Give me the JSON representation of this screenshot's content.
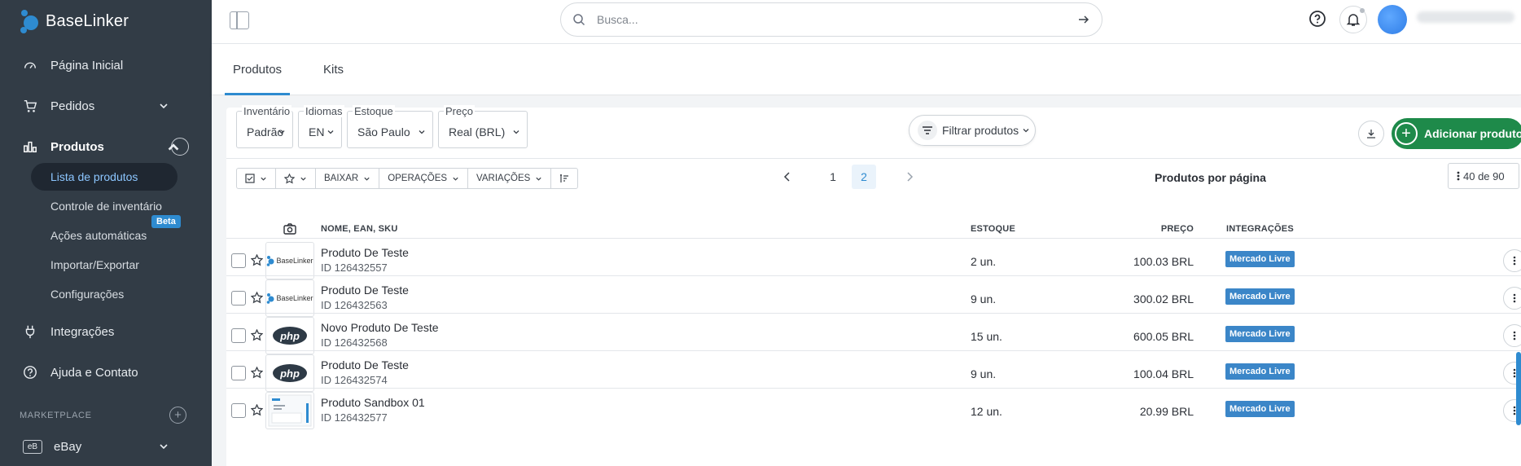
{
  "app": {
    "brand": "BaseLinker"
  },
  "sidebar": {
    "items": [
      {
        "label": "Página Inicial",
        "icon": "gauge-icon"
      },
      {
        "label": "Pedidos",
        "icon": "cart-icon"
      },
      {
        "label": "Produtos",
        "icon": "products-icon"
      },
      {
        "label": "Integrações",
        "icon": "plug-icon"
      },
      {
        "label": "Ajuda e Contato",
        "icon": "help-icon"
      }
    ],
    "products_sub": [
      {
        "label": "Lista de produtos"
      },
      {
        "label": "Controle de inventário"
      },
      {
        "label": "Ações automáticas",
        "badge": "Beta"
      },
      {
        "label": "Importar/Exportar"
      },
      {
        "label": "Configurações"
      }
    ],
    "marketplace_label": "MARKETPLACE",
    "marketplace": [
      {
        "badge": "eB",
        "label": "eBay"
      }
    ]
  },
  "topbar": {
    "search_placeholder": "Busca..."
  },
  "tabs": [
    {
      "label": "Produtos",
      "active": true
    },
    {
      "label": "Kits",
      "active": false
    }
  ],
  "filters": [
    {
      "label": "Inventário",
      "value": "Padrão"
    },
    {
      "label": "Idiomas",
      "value": "EN"
    },
    {
      "label": "Estoque",
      "value": "São Paulo"
    },
    {
      "label": "Preço",
      "value": "Real (BRL)"
    }
  ],
  "filter_button": "Filtrar produtos",
  "add_button": "Adicionar produto",
  "toolbar": {
    "baixar": "BAIXAR",
    "operacoes": "OPERAÇÕES",
    "variacoes": "VARIAÇÕES"
  },
  "pagination": {
    "pages": [
      "1",
      "2"
    ],
    "current": "2"
  },
  "per_page": {
    "label": "Produtos por página",
    "value": "40 de 90"
  },
  "table": {
    "headers": {
      "name": "NOME, EAN, SKU",
      "stock": "ESTOQUE",
      "price": "PREÇO",
      "integrations": "INTEGRAÇÕES"
    },
    "rows": [
      {
        "name": "Produto De Teste",
        "id": "ID 126432557",
        "stock": "2 un.",
        "price": "100.03 BRL",
        "integration": "Mercado Livre",
        "thumb": "baselinker"
      },
      {
        "name": "Produto De Teste",
        "id": "ID 126432563",
        "stock": "9 un.",
        "price": "300.02 BRL",
        "integration": "Mercado Livre",
        "thumb": "baselinker"
      },
      {
        "name": "Novo Produto De Teste",
        "id": "ID 126432568",
        "stock": "15 un.",
        "price": "600.05 BRL",
        "integration": "Mercado Livre",
        "thumb": "php"
      },
      {
        "name": "Produto De Teste",
        "id": "ID 126432574",
        "stock": "9 un.",
        "price": "100.04 BRL",
        "integration": "Mercado Livre",
        "thumb": "php"
      },
      {
        "name": "Produto Sandbox 01",
        "id": "ID 126432577",
        "stock": "12 un.",
        "price": "20.99 BRL",
        "integration": "Mercado Livre",
        "thumb": "screenshot"
      }
    ]
  },
  "thumb_texts": {
    "baselinker": "BaseLinker",
    "php": "php"
  },
  "colors": {
    "sidebar": "#323c46",
    "accent": "#2e8bd0",
    "add": "#1e8a4a",
    "integration": "#3b86c8"
  }
}
